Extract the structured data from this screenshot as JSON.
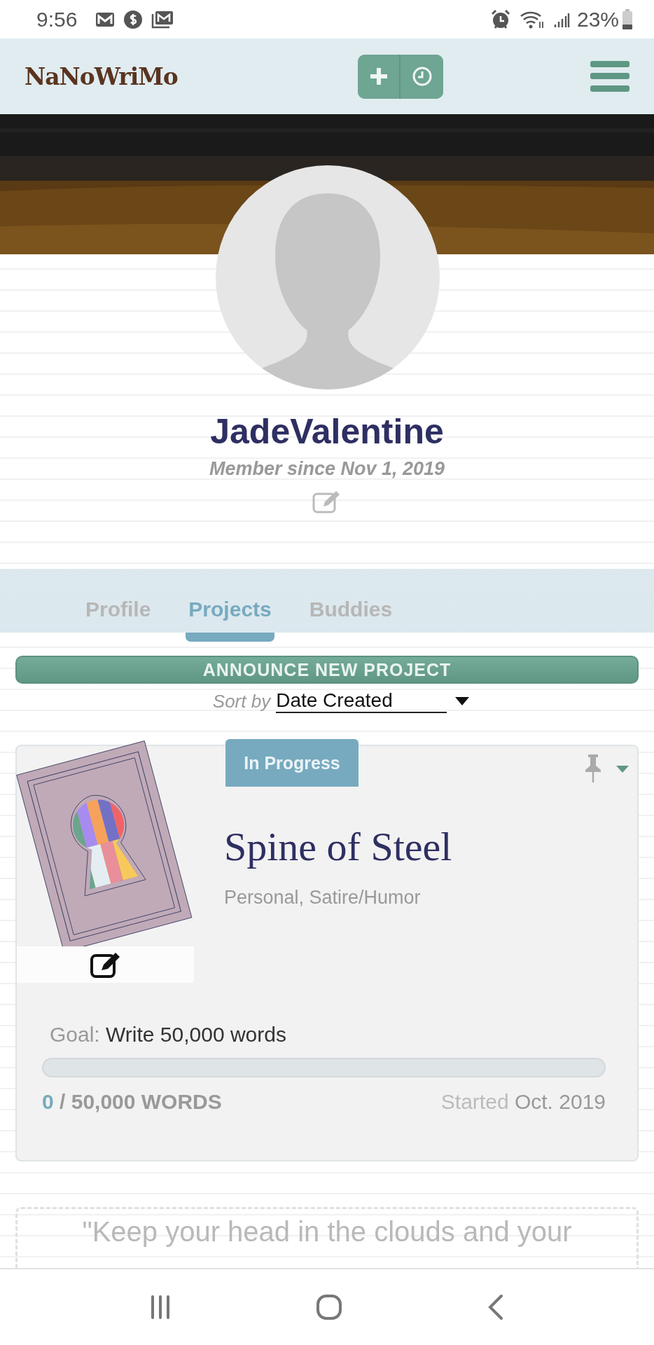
{
  "status_bar": {
    "time": "9:56",
    "battery": "23%"
  },
  "header": {
    "logo": "NaNoWriMo"
  },
  "profile": {
    "username": "JadeValentine",
    "member_since": "Member since Nov 1, 2019"
  },
  "tabs": [
    {
      "label": "Profile",
      "selected": false
    },
    {
      "label": "Projects",
      "selected": true
    },
    {
      "label": "Buddies",
      "selected": false
    }
  ],
  "announce_button": {
    "label": "ANNOUNCE NEW PROJECT"
  },
  "sort": {
    "label": "Sort by",
    "value": "Date Created"
  },
  "project": {
    "status": "In Progress",
    "title": "Spine of Steel",
    "genres": "Personal, Satire/Humor",
    "goal_label": "Goal:",
    "goal": "Write 50,000 words",
    "progress": {
      "level": 0
    },
    "words_current": "0",
    "words_total": "/ 50,000 WORDS",
    "started_label": "Started",
    "started": "Oct. 2019"
  },
  "quote": {
    "text": "\"Keep your head in the clouds and your"
  }
}
